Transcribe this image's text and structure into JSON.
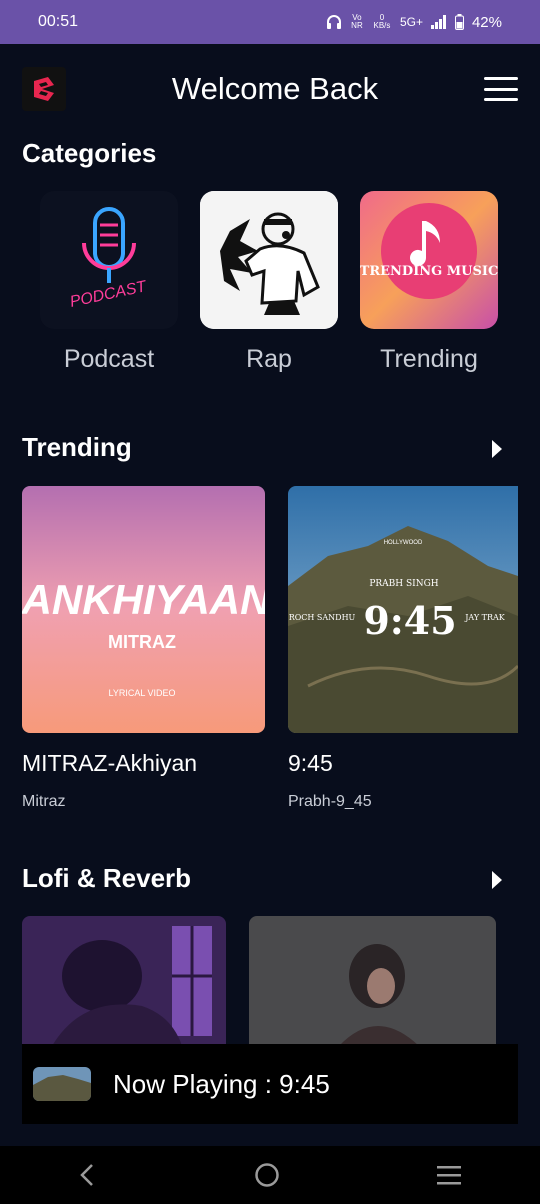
{
  "status_bar": {
    "time": "00:51",
    "volte": "Vo NR",
    "speed": "0 KB/s",
    "network": "5G+",
    "battery": "42%"
  },
  "header": {
    "title": "Welcome Back",
    "logo_icon": "app-logo-icon",
    "menu_icon": "hamburger-menu-icon"
  },
  "categories": {
    "heading": "Categories",
    "items": [
      {
        "label": "Podcast",
        "art_text": "PODCAST"
      },
      {
        "label": "Rap"
      },
      {
        "label": "Trending",
        "art_text": "TRENDING MUSIC"
      }
    ]
  },
  "trending": {
    "heading": "Trending",
    "items": [
      {
        "title": "MITRAZ-Akhiyan",
        "artist": "Mitraz",
        "art_title": "ANKHIYAAN",
        "art_sub": "MITRAZ",
        "art_note": "LYRICAL VIDEO"
      },
      {
        "title": "9:45",
        "artist": "Prabh-9_45",
        "art_title": "9:45",
        "art_top": "PRABH SINGH",
        "art_left": "ROCH SANDHU",
        "art_right": "JAY TRAK",
        "art_sign": "HOLLYWOOD"
      }
    ]
  },
  "lofi": {
    "heading": "Lofi & Reverb"
  },
  "now_playing": {
    "text": "Now Playing : 9:45"
  },
  "colors": {
    "background": "#080d1c",
    "status_bar": "#6a52a8",
    "accent_logo": "#e8264f"
  },
  "nav": {
    "back_icon": "back-icon",
    "home_icon": "home-icon",
    "recents_icon": "recents-icon"
  }
}
